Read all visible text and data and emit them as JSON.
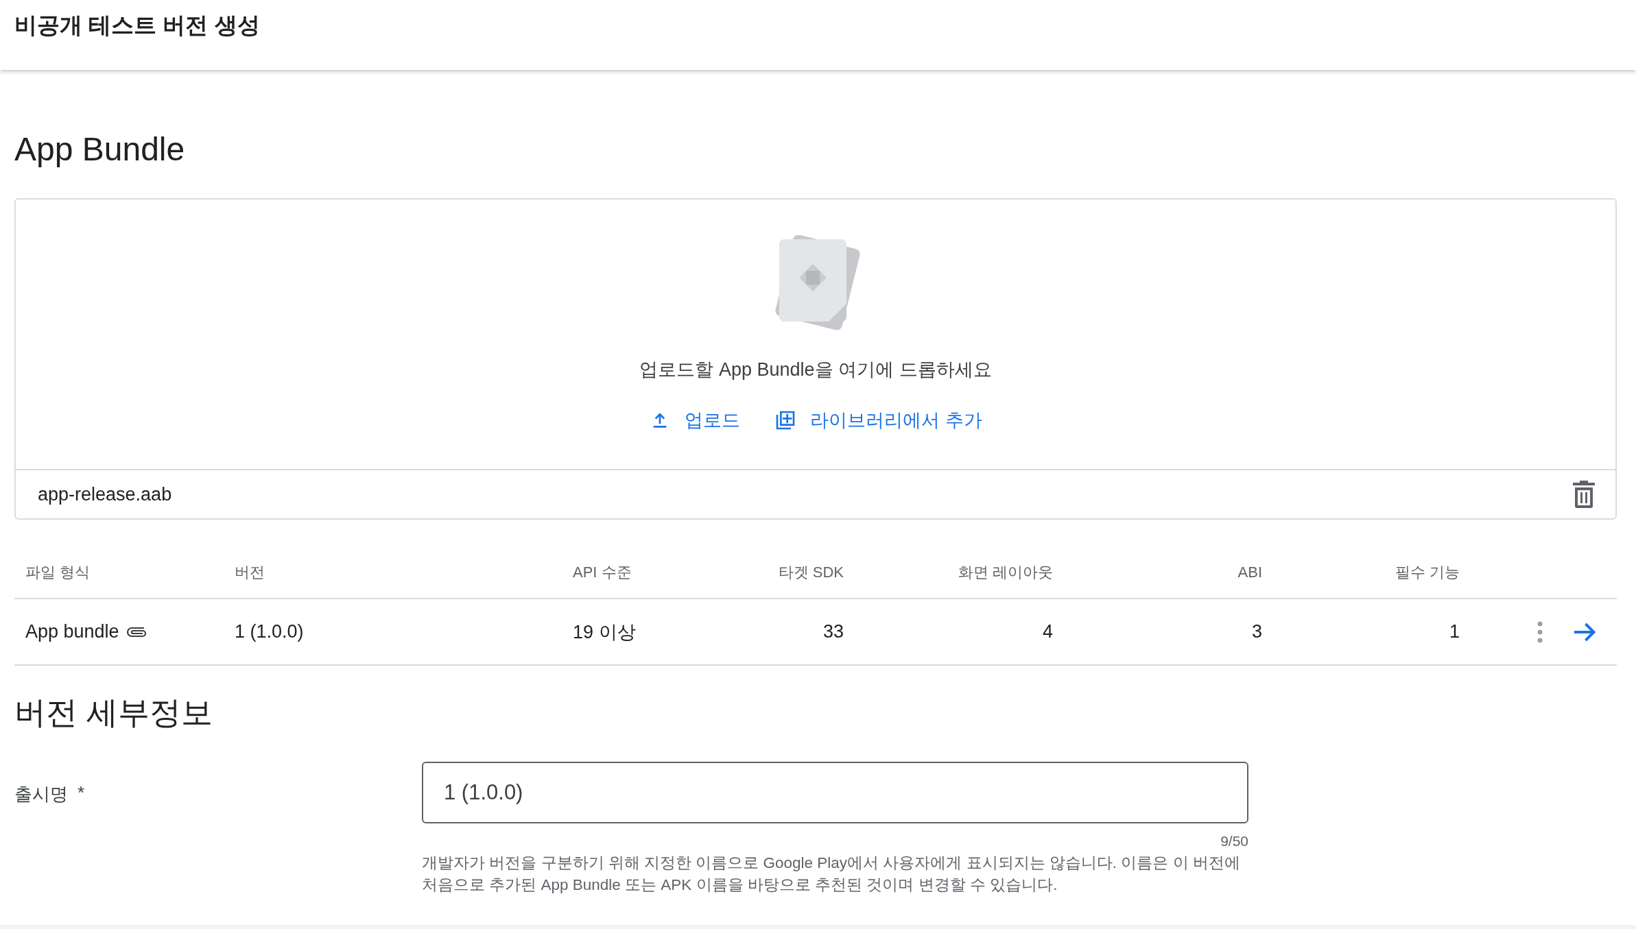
{
  "header": {
    "title": "비공개 테스트 버전 생성"
  },
  "app_bundle": {
    "heading": "App Bundle",
    "dropzone": {
      "prompt": "업로드할 App Bundle을 여기에 드롭하세요",
      "actions": [
        {
          "kind": "upload",
          "label": "업로드"
        },
        {
          "kind": "library",
          "label": "라이브러리에서 추가"
        }
      ]
    },
    "file": {
      "name": "app-release.aab"
    },
    "table": {
      "columns": [
        "파일 형식",
        "버전",
        "API 수준",
        "타겟 SDK",
        "화면 레이아웃",
        "ABI",
        "필수 기능"
      ],
      "rows": [
        {
          "cells": [
            "App bundle",
            "1 (1.0.0)",
            "19 이상",
            "33",
            "4",
            "3",
            "1"
          ]
        }
      ]
    }
  },
  "version_details": {
    "heading": "버전 세부정보",
    "release_name": {
      "label": "출시명",
      "required_mark": "*",
      "value": "1 (1.0.0)",
      "counter": "9/50",
      "help": "개발자가 버전을 구분하기 위해 지정한 이름으로 Google Play에서 사용자에게 표시되지는 않습니다. 이름은 이 버전에 처음으로 추가된 App Bundle 또는 APK 이름을 바탕으로 추천된 것이며 변경할 수 있습니다."
    }
  }
}
